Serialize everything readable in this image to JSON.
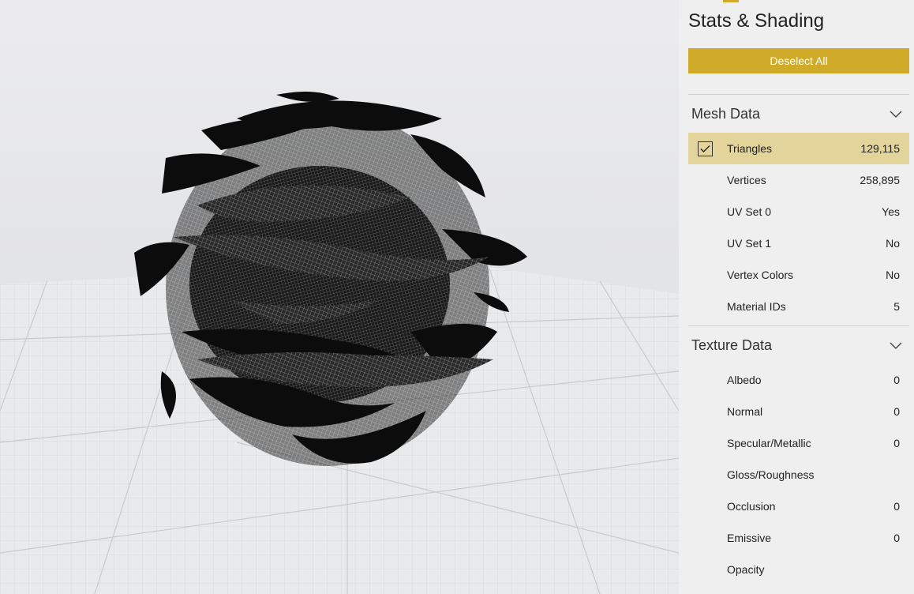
{
  "panel": {
    "title": "Stats & Shading",
    "deselect_label": "Deselect All",
    "accent_color": "#cfab29",
    "selected_row_color": "#e2d49a"
  },
  "mesh_data": {
    "title": "Mesh Data",
    "rows": [
      {
        "label": "Triangles",
        "value": "129,115",
        "selected": true
      },
      {
        "label": "Vertices",
        "value": "258,895"
      },
      {
        "label": "UV Set 0",
        "value": "Yes"
      },
      {
        "label": "UV Set 1",
        "value": "No"
      },
      {
        "label": "Vertex Colors",
        "value": "No"
      },
      {
        "label": "Material IDs",
        "value": "5"
      }
    ]
  },
  "texture_data": {
    "title": "Texture Data",
    "rows": [
      {
        "label": "Albedo",
        "value": "0"
      },
      {
        "label": "Normal",
        "value": "0"
      },
      {
        "label": "Specular/Metallic",
        "value": "0"
      },
      {
        "label": "Gloss/Roughness",
        "value": ""
      },
      {
        "label": "Occlusion",
        "value": "0"
      },
      {
        "label": "Emissive",
        "value": "0"
      },
      {
        "label": "Opacity",
        "value": ""
      }
    ]
  },
  "icons": {
    "section_toggle": "chevron-down-icon",
    "row_check": "checkmark-icon"
  }
}
